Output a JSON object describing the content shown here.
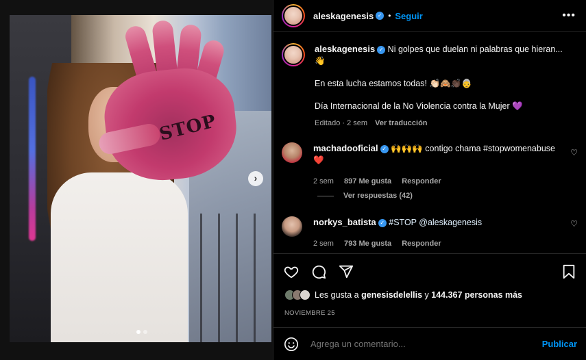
{
  "post": {
    "author": "aleskagenesis",
    "follow_label": "Seguir",
    "follow_dot": "•",
    "more_label": "•••",
    "stop_text": "STOP",
    "next_label": "›"
  },
  "caption": {
    "username": "aleskagenesis",
    "line1": "Ni golpes que duelan ni palabras que hieran... 👋",
    "line2": "En esta lucha estamos todas! 👏🏻🙈👏🏿👵",
    "line3": "Día Internacional de la No Violencia contra la Mujer 💜",
    "edited": "Editado · 2 sem",
    "translate": "Ver traducción"
  },
  "comments": [
    {
      "username": "machadooficial",
      "text": "🙌🙌🙌 contigo chama #stopwomenabuse ❤️",
      "time": "2 sem",
      "likes": "897 Me gusta",
      "reply": "Responder"
    },
    {
      "username": "norkys_batista",
      "text": "#STOP @aleskagenesis",
      "time": "2 sem",
      "likes": "793 Me gusta",
      "reply": "Responder"
    }
  ],
  "replies_label": "Ver respuestas (42)",
  "likes": {
    "prefix": "Les gusta a",
    "user": "genesisdelellis",
    "middle": "y",
    "count": "144.367 personas más"
  },
  "date": "NOVIEMBRE 25",
  "comment_box": {
    "placeholder": "Agrega un comentario...",
    "publish": "Publicar"
  },
  "carousel": {
    "slide_count": 2,
    "active_index": 0
  },
  "colors": {
    "accent": "#0095f6",
    "verified": "#3897f0",
    "background": "#000000",
    "muted_text": "#a8a8a8"
  },
  "icons": {
    "like": "heart-icon",
    "comment": "comment-icon",
    "share": "share-icon",
    "save": "bookmark-icon",
    "emoji": "emoji-icon",
    "more": "more-options-icon",
    "verified": "verified-badge-icon",
    "next": "chevron-right-icon"
  }
}
